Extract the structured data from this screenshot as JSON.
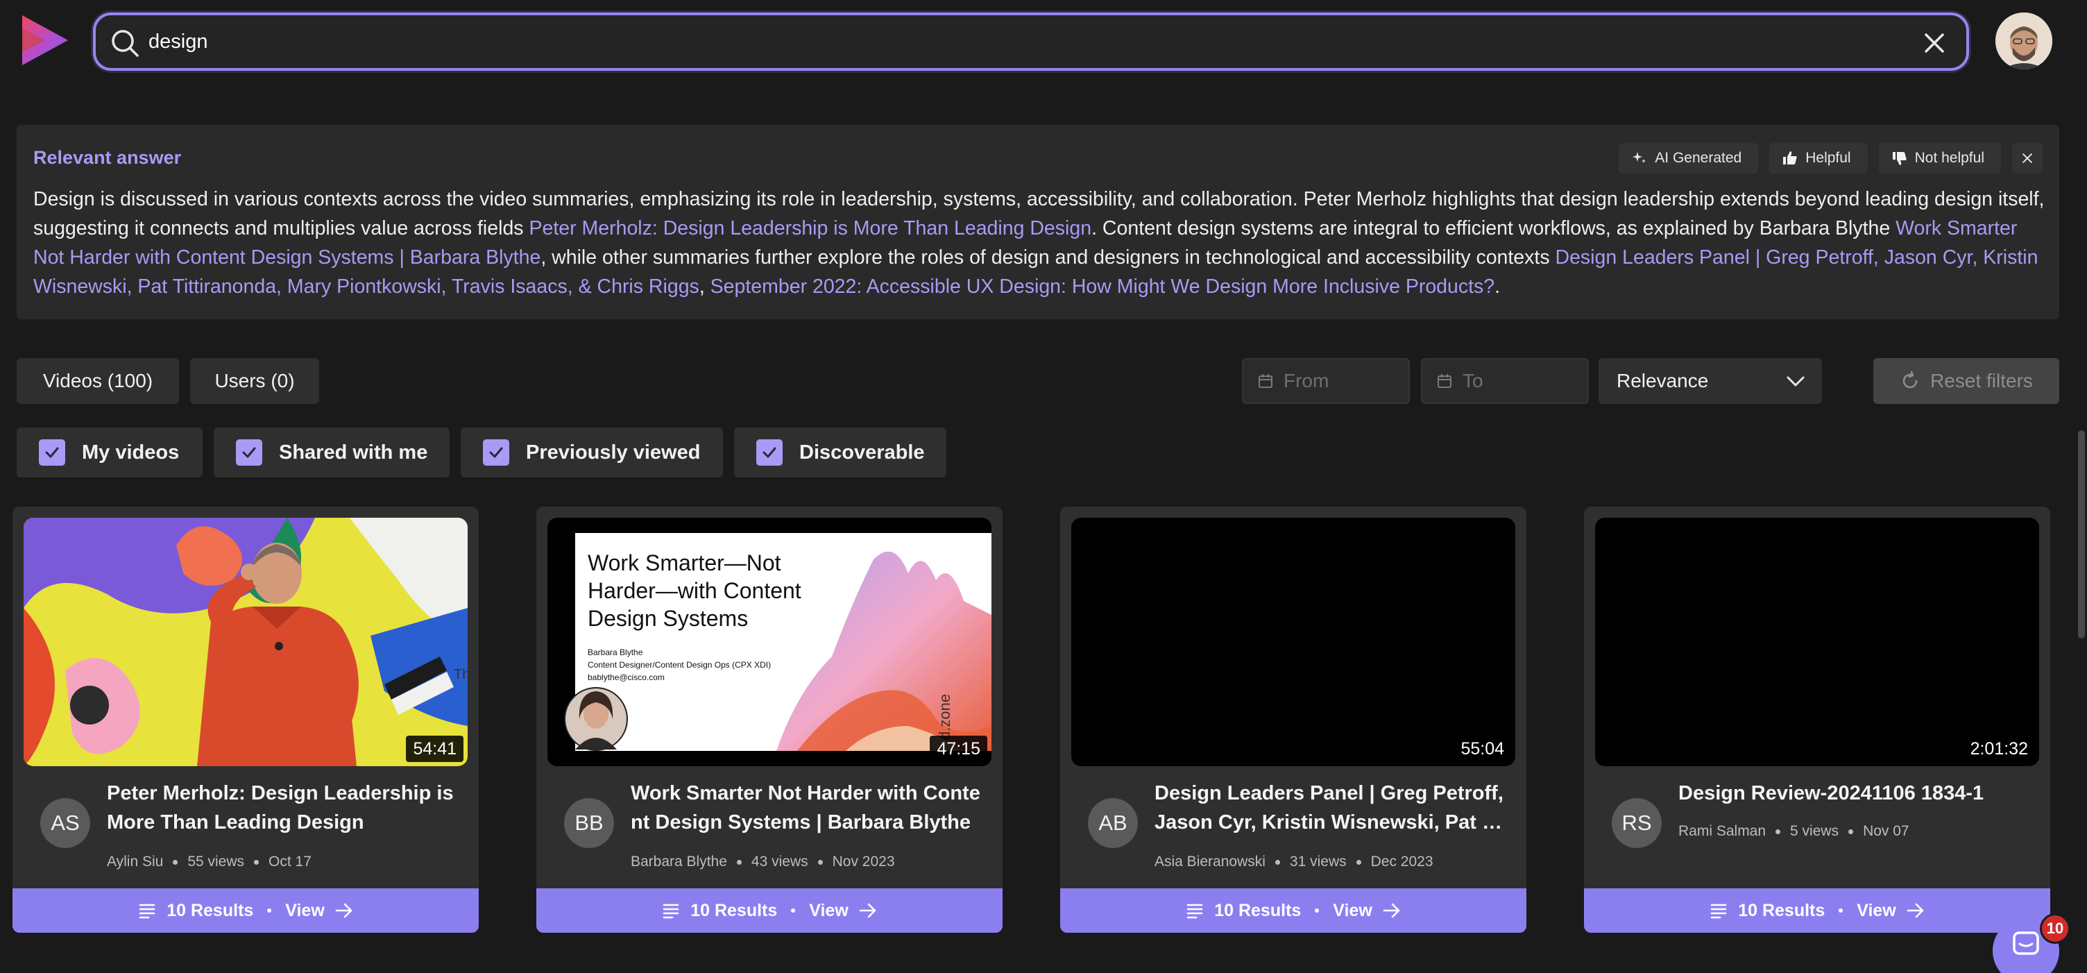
{
  "search": {
    "value": "design"
  },
  "answer": {
    "title": "Relevant answer",
    "actions": {
      "ai_label": "AI Generated",
      "helpful_label": "Helpful",
      "not_helpful_label": "Not helpful"
    },
    "text_1": "Design is discussed in various contexts across the video summaries, emphasizing its role in leadership, systems, accessibility, and collaboration. Peter Merholz highlights that design leadership extends beyond leading design itself, suggesting it connects and multiplies value across fields ",
    "link_1": "Peter Merholz: Design Leadership is More Than Leading Design",
    "text_2": ". Content design systems are integral to efficient workflows, as explained by Barbara Blythe ",
    "link_2": "Work Smarter Not Harder with Content Design Systems | Barbara Blythe",
    "text_3": ", while other summaries further explore the roles of design and designers in technological and accessibility contexts ",
    "link_3": "Design Leaders Panel | Greg Petroff, Jason Cyr, Kristin Wisnewski, Pat Tittiranonda, Mary Piontkowski, Travis Isaacs, & Chris Riggs",
    "text_4": ", ",
    "link_4": "September 2022: Accessible UX Design: How Might We Design More Inclusive Products?",
    "text_5": "."
  },
  "tabs": {
    "videos": "Videos (100)",
    "users": "Users (0)"
  },
  "filters": {
    "from_placeholder": "From",
    "to_placeholder": "To",
    "sort_value": "Relevance",
    "reset_label": "Reset filters",
    "checkboxes": [
      "My videos",
      "Shared with me",
      "Previously viewed",
      "Discoverable"
    ]
  },
  "cards": [
    {
      "title": "Peter Merholz: Design Leadership is More Than Leading Design",
      "initials": "AS",
      "author": "Aylin Siu",
      "views": "55 views",
      "date": "Oct 17",
      "duration": "54:41",
      "results": "10 Results",
      "view": "View"
    },
    {
      "title": "Work Smarter Not Harder with Content Design Systems | Barbara Blythe",
      "initials": "BB",
      "author": "Barbara Blythe",
      "views": "43 views",
      "date": "Nov 2023",
      "duration": "47:15",
      "results": "10 Results",
      "view": "View",
      "slide": {
        "title": "Work Smarter—Not Harder—with Content Design Systems",
        "name": "Barbara Blythe",
        "role": "Content Designer/Content Design Ops (CPX XDI)",
        "email": "bablythe@cisco.com",
        "vertical": "d.zone"
      }
    },
    {
      "title": "Design Leaders Panel | Greg Petroff, Jason Cyr, Kristin Wisnewski, Pat Tittiranonda",
      "initials": "AB",
      "author": "Asia Bieranowski",
      "views": "31 views",
      "date": "Dec 2023",
      "duration": "55:04",
      "results": "10 Results",
      "view": "View"
    },
    {
      "title": "Design Review-20241106 1834-1",
      "initials": "RS",
      "author": "Rami Salman",
      "views": "5 views",
      "date": "Nov 07",
      "duration": "2:01:32",
      "results": "10 Results",
      "view": "View"
    }
  ],
  "chat_badge": "10",
  "colors": {
    "accent": "#8b7ff0",
    "link": "#a79bf5",
    "background": "#1a1a1a",
    "surface": "#2f2f2f",
    "badge": "#d02b2b"
  }
}
